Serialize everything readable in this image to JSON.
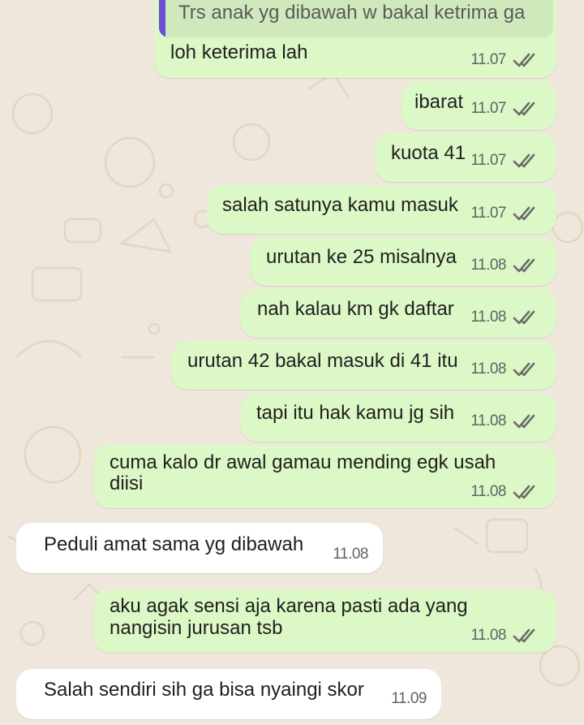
{
  "chat": {
    "quoted_text": "Trs anak yg dibawah w bakal ketrima ga",
    "messages": [
      {
        "dir": "out",
        "text": "loh keterima lah",
        "time": "11.07"
      },
      {
        "dir": "out",
        "text": "ibarat",
        "time": "11.07"
      },
      {
        "dir": "out",
        "text": "kuota 41",
        "time": "11.07"
      },
      {
        "dir": "out",
        "text": "salah satunya kamu masuk",
        "time": "11.07"
      },
      {
        "dir": "out",
        "text": "urutan ke 25 misalnya",
        "time": "11.08"
      },
      {
        "dir": "out",
        "text": "nah kalau km gk daftar",
        "time": "11.08"
      },
      {
        "dir": "out",
        "text": "urutan 42 bakal masuk di 41 itu",
        "time": "11.08"
      },
      {
        "dir": "out",
        "text": "tapi itu hak kamu jg sih",
        "time": "11.08"
      },
      {
        "dir": "out",
        "text_line1": "cuma kalo dr awal gamau mending egk usah",
        "text_line2": "diisi",
        "time": "11.08"
      },
      {
        "dir": "in",
        "text": "Peduli amat sama yg dibawah",
        "time": "11.08"
      },
      {
        "dir": "out",
        "text_line1": "aku agak sensi aja karena pasti ada yang",
        "text_line2": "nangisin jurusan tsb",
        "time": "11.08"
      },
      {
        "dir": "in",
        "text": "Salah sendiri sih ga bisa nyaingi skor",
        "time": "11.09"
      }
    ]
  },
  "colors": {
    "outgoing_bubble": "#dcf8c6",
    "incoming_bubble": "#ffffff",
    "background": "#efe7dc",
    "quote_bar": "#6b4fd8"
  },
  "icons": {
    "read_receipt": "double-check-icon"
  }
}
